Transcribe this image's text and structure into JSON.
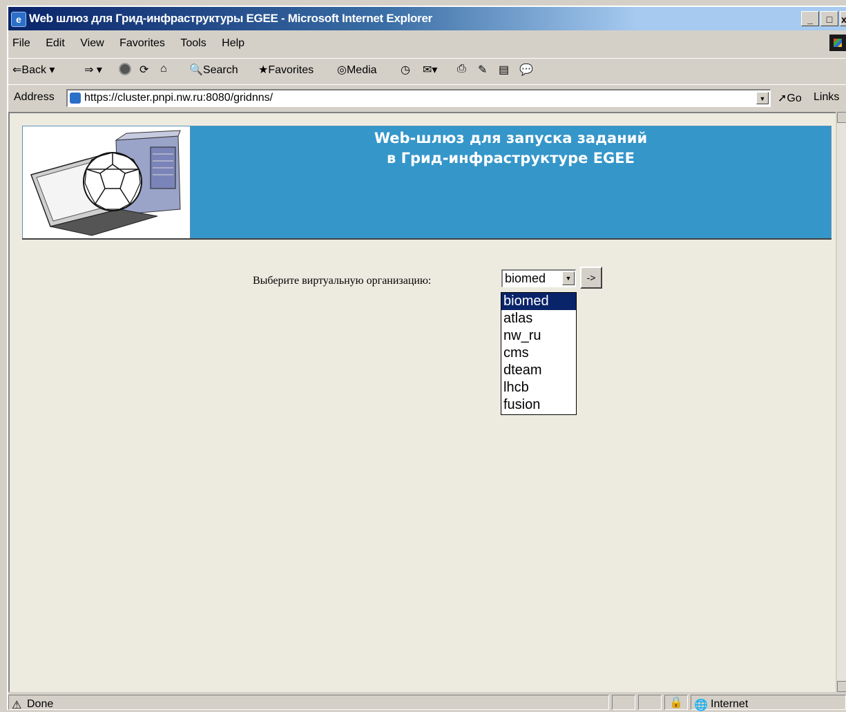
{
  "window": {
    "title": "Web шлюз для Грид-инфраструктуры EGEE - Microsoft Internet Explorer",
    "minimize": "_",
    "maximize": "□",
    "close": "x"
  },
  "menu": [
    "File",
    "Edit",
    "View",
    "Favorites",
    "Tools",
    "Help"
  ],
  "toolbar": {
    "back": "Back",
    "search": "Search",
    "favorites": "Favorites",
    "media": "Media"
  },
  "address": {
    "label": "Address",
    "url": "https://cluster.pnpi.nw.ru:8080/gridnns/",
    "go": "Go",
    "links": "Links"
  },
  "banner": {
    "line1": "Web-шлюз для запуска заданий",
    "line2": "в Грид-инфраструктуре EGEE"
  },
  "form": {
    "label": "Выберите виртуальную организацию:",
    "selected": "biomed",
    "submit": "->",
    "options": [
      "biomed",
      "atlas",
      "nw_ru",
      "cms",
      "dteam",
      "lhcb",
      "fusion"
    ]
  },
  "status": {
    "text": "Done",
    "zone": "Internet"
  },
  "colors": {
    "banner": "#3596c9",
    "page_bg": "#edebe0",
    "highlight": "#0a246a"
  }
}
